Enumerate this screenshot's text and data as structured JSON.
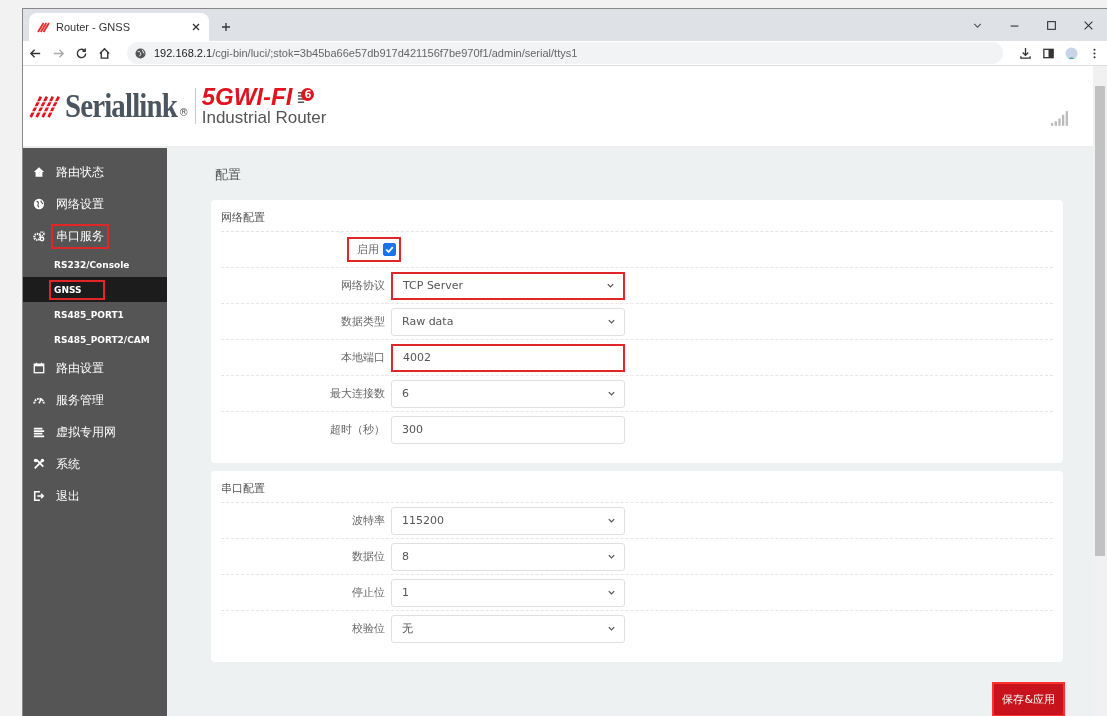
{
  "browser": {
    "tab_title": "Router - GNSS",
    "url_host": "192.168.2.1",
    "url_path": "/cgi-bin/luci/;stok=3b45ba66e57db917d421156f7be970f1/admin/serial/ttys1"
  },
  "header": {
    "brand": "Seriallink",
    "brand_mark": "®",
    "product": "5GWI-FI",
    "product_badge": "6",
    "subtitle": "Industrial Router"
  },
  "sidebar": {
    "items": [
      {
        "label": "路由状态",
        "selected": false,
        "highlighted": false
      },
      {
        "label": "网络设置",
        "selected": false,
        "highlighted": false
      },
      {
        "label": "串口服务",
        "selected": false,
        "highlighted": true,
        "children": [
          {
            "label": "RS232/Console",
            "selected": false,
            "highlighted": false
          },
          {
            "label": "GNSS",
            "selected": true,
            "highlighted": true
          },
          {
            "label": "RS485_PORT1",
            "selected": false,
            "highlighted": false
          },
          {
            "label": "RS485_PORT2/CAM",
            "selected": false,
            "highlighted": false
          }
        ]
      },
      {
        "label": "路由设置",
        "selected": false,
        "highlighted": false
      },
      {
        "label": "服务管理",
        "selected": false,
        "highlighted": false
      },
      {
        "label": "虚拟专用网",
        "selected": false,
        "highlighted": false
      },
      {
        "label": "系统",
        "selected": false,
        "highlighted": false
      },
      {
        "label": "退出",
        "selected": false,
        "highlighted": false
      }
    ]
  },
  "page_title": "配置",
  "sections": [
    {
      "title": "网络配置",
      "fields": [
        {
          "kind": "checkbox",
          "label": "启用",
          "checked": true,
          "highlighted": true
        },
        {
          "kind": "select",
          "label": "网络协议",
          "value": "TCP Server",
          "highlighted": true
        },
        {
          "kind": "select",
          "label": "数据类型",
          "value": "Raw data",
          "highlighted": false
        },
        {
          "kind": "text",
          "label": "本地端口",
          "value": "4002",
          "highlighted": true
        },
        {
          "kind": "select",
          "label": "最大连接数",
          "value": "6",
          "highlighted": false
        },
        {
          "kind": "text",
          "label": "超时（秒）",
          "value": "300",
          "highlighted": false
        }
      ]
    },
    {
      "title": "串口配置",
      "fields": [
        {
          "kind": "select",
          "label": "波特率",
          "value": "115200",
          "highlighted": false
        },
        {
          "kind": "select",
          "label": "数据位",
          "value": "8",
          "highlighted": false
        },
        {
          "kind": "select",
          "label": "停止位",
          "value": "1",
          "highlighted": false
        },
        {
          "kind": "select",
          "label": "校验位",
          "value": "无",
          "highlighted": false
        }
      ]
    }
  ],
  "save_button": {
    "label": "保存&应用",
    "highlighted": true
  }
}
